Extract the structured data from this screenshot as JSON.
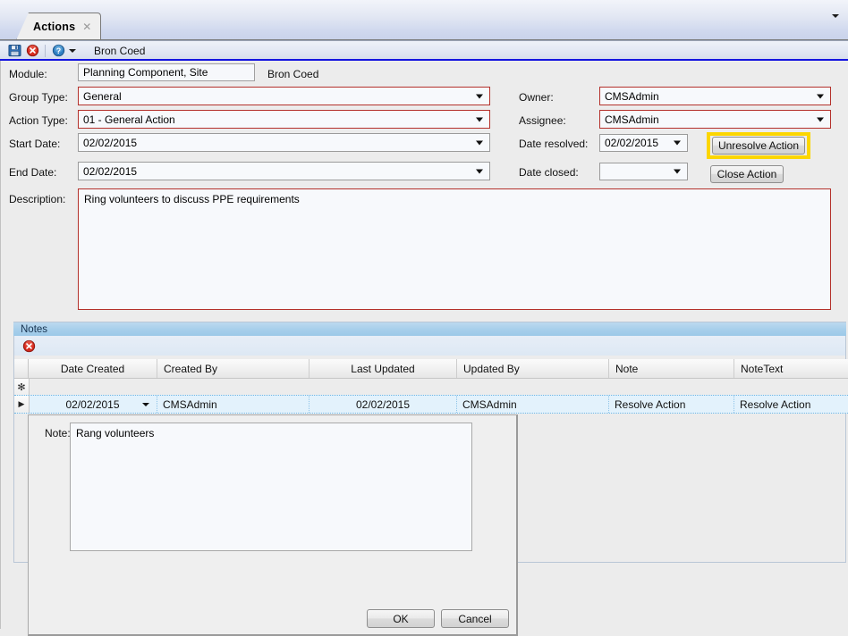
{
  "window": {
    "tab": {
      "label": "Actions",
      "close_icon": "close-icon"
    },
    "overflow_icon": "chevron-down-icon"
  },
  "toolbar": {
    "save_icon": "save-floppy-icon",
    "cancel_icon": "red-x-cancel-icon",
    "help_icon": "help-question-icon",
    "help_dropdown_icon": "chevron-down-icon",
    "title": "Bron Coed"
  },
  "form": {
    "labels": {
      "module": "Module:",
      "group_type": "Group Type:",
      "action_type": "Action Type:",
      "start_date": "Start Date:",
      "end_date": "End Date:",
      "description": "Description:",
      "owner": "Owner:",
      "assignee": "Assignee:",
      "date_resolved": "Date resolved:",
      "date_closed": "Date closed:"
    },
    "values": {
      "module": "Planning Component, Site",
      "module_suffix": "Bron Coed",
      "group_type": "General",
      "action_type": "01 - General Action",
      "start_date": "02/02/2015",
      "end_date": "02/02/2015",
      "description": "Ring volunteers to discuss PPE requirements",
      "owner": "CMSAdmin",
      "assignee": "CMSAdmin",
      "date_resolved": "02/02/2015",
      "date_closed": ""
    },
    "buttons": {
      "unresolve_action": "Unresolve Action",
      "close_action": "Close Action"
    }
  },
  "notes": {
    "group_title": "Notes",
    "delete_icon": "red-x-delete-icon",
    "columns": [
      "Date Created",
      "Created By",
      "Last Updated",
      "Updated By",
      "Note",
      "NoteText"
    ],
    "new_row_marker": "✻",
    "current_row_marker": "▶",
    "rows": [
      {
        "date_created": "02/02/2015",
        "created_by": "CMSAdmin",
        "last_updated": "02/02/2015",
        "updated_by": "CMSAdmin",
        "note": "Resolve Action",
        "note_text": "Resolve Action"
      }
    ]
  },
  "note_editor": {
    "label": "Note:",
    "value": "Rang volunteers",
    "ok_label": "OK",
    "cancel_label": "Cancel"
  },
  "colors": {
    "required_border": "#b4312b",
    "highlight": "#fcd600",
    "accent_rule": "#1414e0",
    "group_header": "#a8cfeb",
    "row_selection": "#e3f2fc"
  }
}
